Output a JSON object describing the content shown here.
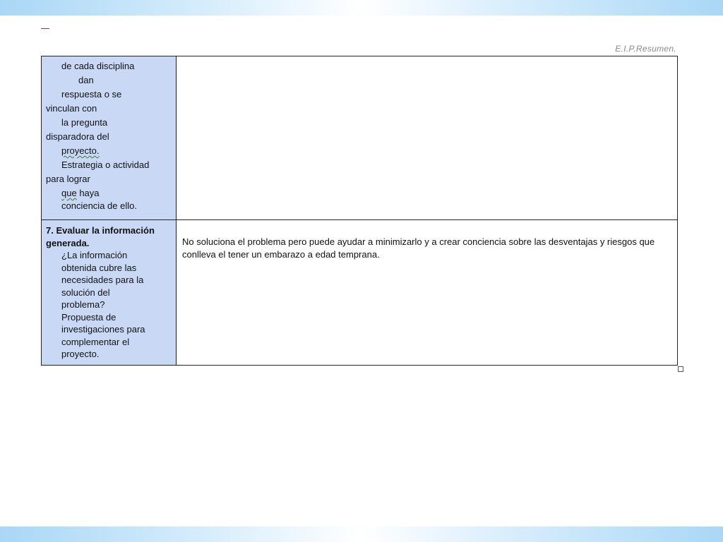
{
  "header": {
    "text": "E.I.P.Resumen."
  },
  "table": {
    "row1_left": [
      "de cada disciplina",
      "dan",
      "respuesta  o se",
      "vinculan con",
      "la pregunta",
      "disparadora del",
      "proyecto.",
      "Estrategia o  actividad",
      "para lograr",
      "que",
      "haya",
      "conciencia de ello."
    ],
    "row2_left": {
      "title_line1": "7.  Evaluar la información",
      "title_line2": "generada.",
      "lines": [
        "¿La información",
        "obtenida cubre las",
        "necesidades para la",
        "solución del",
        "problema?",
        "Propuesta de",
        "investigaciones para",
        "complementar el",
        "proyecto."
      ]
    },
    "row2_right": "No soluciona el problema pero puede ayudar a minimizarlo y a crear conciencia sobre las desventajas  y riesgos que conlleva el tener un embarazo a edad temprana."
  }
}
